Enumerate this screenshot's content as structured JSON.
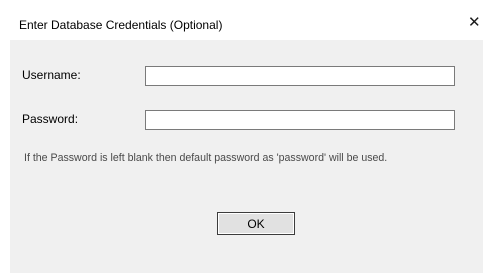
{
  "dialog": {
    "title": "Enter Database Credentials (Optional)",
    "close_glyph": "✕"
  },
  "form": {
    "username_label": "Username:",
    "username_value": "",
    "password_label": "Password:",
    "password_value": "",
    "hint": "If the Password is left blank then default password as 'password' will be used."
  },
  "buttons": {
    "ok_label": "OK"
  }
}
